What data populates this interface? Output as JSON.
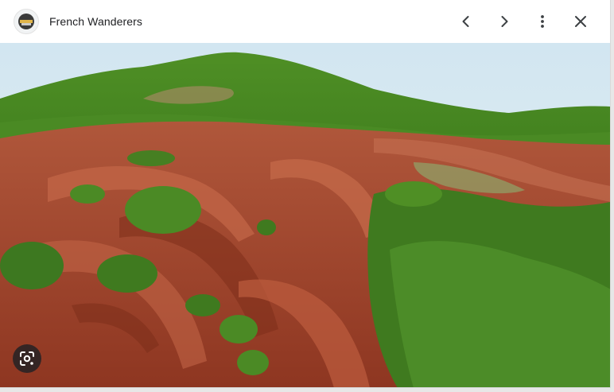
{
  "header": {
    "site_name": "French Wanderers",
    "favicon_icon": "site-logo-icon",
    "prev_icon": "chevron-left-icon",
    "next_icon": "chevron-right-icon",
    "more_icon": "more-vert-icon",
    "close_icon": "close-icon"
  },
  "photo": {
    "subject": "aerial view of red eroded ravines with green forested hill",
    "colors": {
      "sky": "#d6e8f2",
      "red_earth": "#a4442b",
      "forest": "#3f7a1f"
    }
  },
  "lens_button": {
    "icon": "google-lens-icon"
  }
}
